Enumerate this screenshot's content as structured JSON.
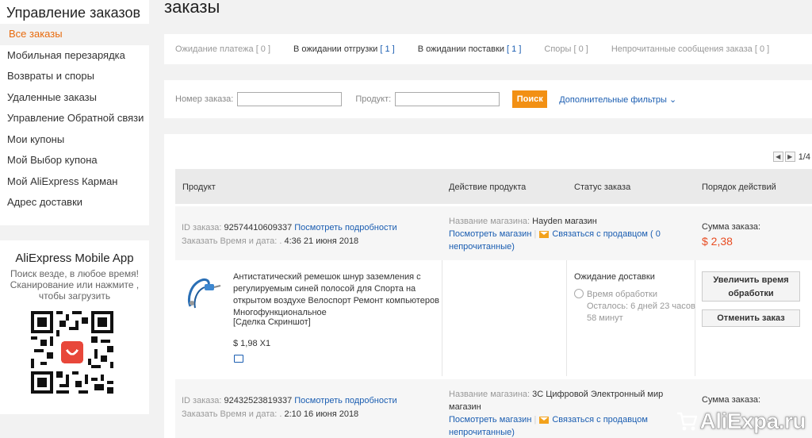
{
  "sidebar": {
    "title": "Управление заказов",
    "items": [
      {
        "label": "Все заказы",
        "active": true
      },
      {
        "label": "Мобильная перезарядка"
      },
      {
        "label": "Возвраты и споры"
      },
      {
        "label": "Удаленные заказы"
      },
      {
        "label": "Управление Обратной связи"
      },
      {
        "label": "Мои купоны"
      },
      {
        "label": "Мой Выбор купона"
      },
      {
        "label": "Мой AliExpress Карман"
      },
      {
        "label": "Адрес доставки"
      }
    ]
  },
  "app_promo": {
    "title": "AliExpress Mobile App",
    "line1": "Поиск везде, в любое время!",
    "line2": "Сканирование или нажмите ,",
    "line3": "чтобы загрузить"
  },
  "page_title": "заказы",
  "status_tabs": [
    {
      "label": "Ожидание платежа",
      "count": "[ 0 ]"
    },
    {
      "label": "В ожидании отгрузки",
      "count": "[ 1 ]"
    },
    {
      "label": "В ожидании поставки",
      "count": "[ 1 ]"
    },
    {
      "label": "Споры",
      "count": "[ 0 ]"
    },
    {
      "label": "Непрочитанные сообщения заказа",
      "count": "[ 0 ]"
    }
  ],
  "filters": {
    "order_no_label": "Номер заказа:",
    "product_label": "Продукт:",
    "order_no_value": "",
    "product_value": "",
    "search_button": "Поиск",
    "more_filters": "Дополнительные фильтры"
  },
  "pager": {
    "text": "1/4"
  },
  "table_headers": {
    "product": "Продукт",
    "product_action": "Действие продукта",
    "order_status": "Статус заказа",
    "actions": "Порядок действий"
  },
  "orders": [
    {
      "id_label": "ID заказа:",
      "id": "92574410609337",
      "details_link": "Посмотреть подробности",
      "date_label": "Заказать Время и дата: .",
      "date": "4:36 21 июня 2018",
      "store_label": "Название магазина:",
      "store": "Hayden магазин",
      "view_store": "Посмотреть магазин",
      "contact": "Связаться с продавцом",
      "unread": "( 0",
      "unread2": "непрочитанные)",
      "total_label": "Сумма заказа:",
      "total": "$ 2,38",
      "product_title": "Антистатический ремешок шнур заземления с регулируемым синей полосой для Спорта на открытом воздухе Велоспорт Ремонт компьютеров Многофункциональное",
      "snapshot": "[Сделка Скриншот]",
      "price": "$ 1,98 X1",
      "status": "Ожидание доставки",
      "processing_label": "Время обработки",
      "remaining": "Осталось: 6 дней 23 часов 58 минут",
      "btn_extend": "Увеличить время обработки",
      "btn_cancel": "Отменить заказ"
    },
    {
      "id_label": "ID заказа:",
      "id": "92432523819337",
      "details_link": "Посмотреть подробности",
      "date_label": "Заказать Время и дата: .",
      "date": "2:10 16 июня 2018",
      "store_label": "Название магазина:",
      "store": "3C Цифровой Электронный мир магазин",
      "view_store": "Посмотреть магазин",
      "contact": "Связаться с продавцом",
      "unread2": "непрочитанные)",
      "total_label": "Сумма заказа:"
    }
  ],
  "watermark": "AliExpa.ru",
  "colors": {
    "accent": "#e86a0c",
    "link": "#1a5db1",
    "button": "#f29014",
    "price": "#e84c22"
  }
}
